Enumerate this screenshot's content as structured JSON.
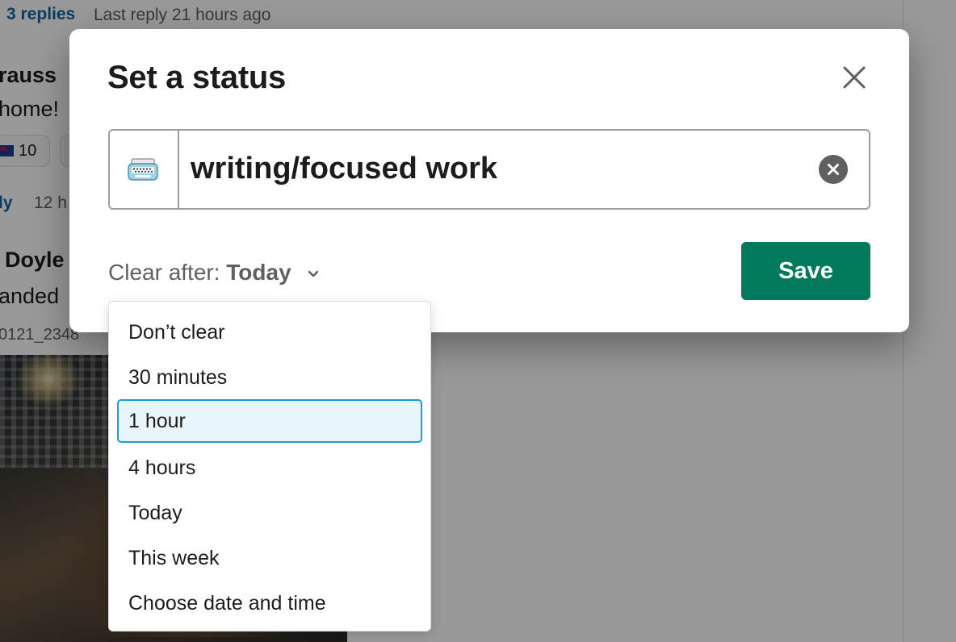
{
  "background": {
    "thread_replies": "3 replies",
    "last_reply": "Last reply 21 hours ago",
    "author1": "rauss",
    "message1": "home!",
    "reaction_count": "10",
    "reply_link": "ly",
    "reply_time": "12 h",
    "author2": "Doyle",
    "message2": "anded",
    "file_name": "0121_2348"
  },
  "modal": {
    "title": "Set a status",
    "status_text": "writing/focused work",
    "emoji_icon": "typewriter-emoji",
    "clear_after_label": "Clear after:",
    "clear_after_value": "Today",
    "save_label": "Save"
  },
  "dropdown": {
    "options": [
      "Don’t clear",
      "30 minutes",
      "1 hour",
      "4 hours",
      "Today",
      "This week",
      "Choose date and time"
    ],
    "highlighted": "1 hour"
  },
  "colors": {
    "save_button": "#007a5a",
    "highlight_border": "#1d9bd1",
    "highlight_bg": "#e8f5fa",
    "link_blue": "#1264a3"
  }
}
